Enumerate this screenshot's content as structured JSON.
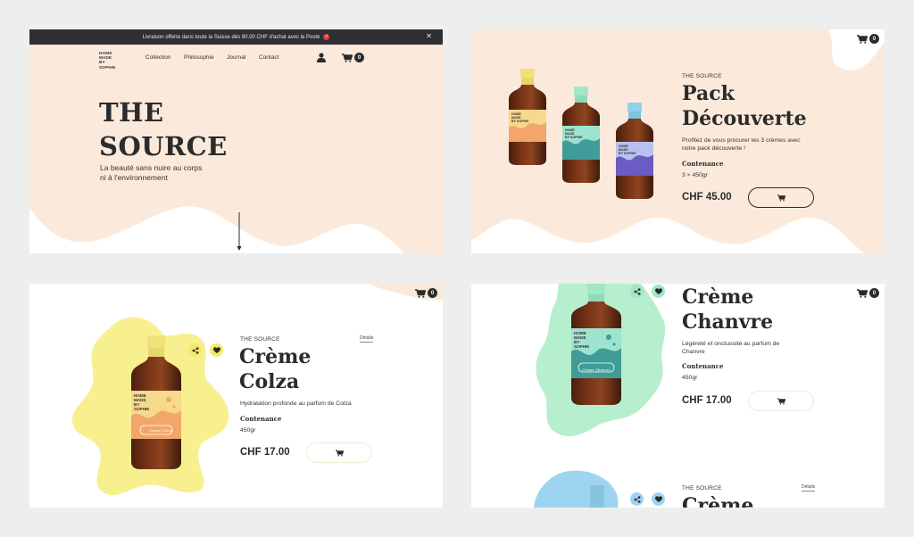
{
  "colors": {
    "peach": "#fbeadb",
    "yellow": "#f8ef8f",
    "mint": "#b6efcd",
    "sky": "#9fd4f0",
    "dark": "#2b2b2b"
  },
  "panel1": {
    "promo_text": "Livraison offerte dans toute la Suisse dès 80.00 CHF d'achat avec la Poste",
    "logo": [
      "HOME",
      "MADE",
      "BY",
      "SOPHIE"
    ],
    "nav": [
      "Collection",
      "Philosophie",
      "Journal",
      "Contact"
    ],
    "cart_count": "0",
    "hero_title_1": "THE",
    "hero_title_2": "SOURCE",
    "hero_subtitle_1": "La beauté sans nuire au corps",
    "hero_subtitle_2": "ni à l'environnement"
  },
  "panel2": {
    "cart_count": "0",
    "eyebrow": "THE SOURCE",
    "title_1": "Pack",
    "title_2": "Découverte",
    "desc_1": "Profitez de vous procurer les 3 crèmes avec",
    "desc_2": "notre pack découverte !",
    "label": "Contenance",
    "value": "3 × 450gr",
    "price": "CHF 45.00"
  },
  "panel3": {
    "cart_count": "0",
    "eyebrow": "THE SOURCE",
    "details": "Détails",
    "title_1": "Crème",
    "title_2": "Colza",
    "desc": "Hydratation profonde au parfum de Colza",
    "label": "Contenance",
    "value": "450gr",
    "price": "CHF 17.00",
    "bottle_label": "Crème Colza"
  },
  "panel4": {
    "cart_count": "0",
    "title_1": "Crème",
    "title_2": "Chanvre",
    "desc_1": "Légèreté et onctuosité au parfum de",
    "desc_2": "Chanvre",
    "label": "Contenance",
    "value": "450gr",
    "price": "CHF 17.00",
    "bottle_label": "Crème Chanvre",
    "next_eyebrow": "THE SOURCE",
    "next_details": "Détails",
    "next_title": "Crème"
  },
  "icons": [
    "cart-icon",
    "user-icon",
    "share-icon",
    "heart-icon",
    "close-icon",
    "arrow-down-icon"
  ]
}
